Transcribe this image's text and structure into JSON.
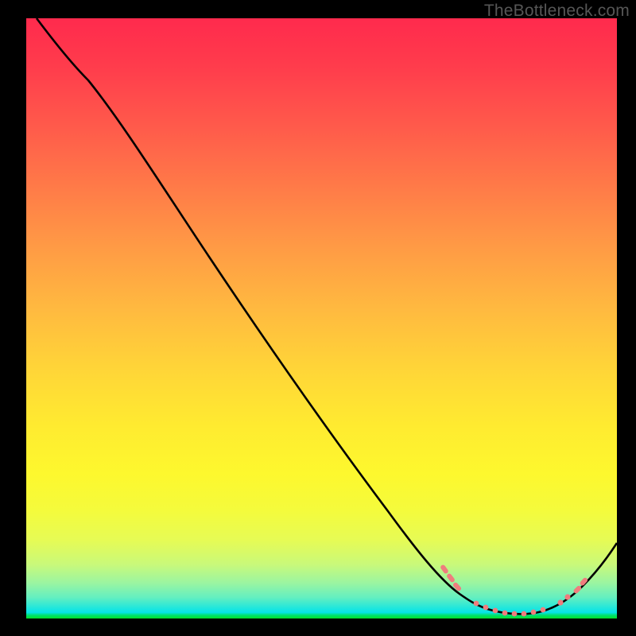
{
  "watermark": "TheBottleneck.com",
  "chart_data": {
    "type": "line",
    "title": "",
    "xlabel": "",
    "ylabel": "",
    "xlim": [
      0,
      100
    ],
    "ylim": [
      0,
      100
    ],
    "grid": false,
    "legend": false,
    "annotations": [],
    "series": [
      {
        "name": "bottleneck-curve",
        "color": "#000000",
        "x": [
          0,
          4,
          9,
          15,
          22,
          30,
          38,
          46,
          54,
          62,
          68,
          72,
          75,
          78,
          81,
          84,
          87,
          90,
          93,
          96,
          100
        ],
        "y": [
          100,
          98,
          95,
          92,
          86,
          78,
          69,
          59,
          49,
          38,
          28,
          20,
          14,
          8,
          4,
          2,
          1,
          2,
          5,
          10,
          18
        ]
      },
      {
        "name": "optimal-zone-markers",
        "color": "#f07878",
        "type": "scatter",
        "x": [
          70,
          71,
          72,
          76,
          78,
          80,
          82,
          84,
          86,
          88,
          90,
          92,
          93
        ],
        "y": [
          22,
          20,
          17,
          9,
          6,
          4,
          3,
          2,
          1,
          2,
          4,
          7,
          9
        ]
      }
    ],
    "background_gradient": {
      "orientation": "vertical",
      "stops": [
        {
          "pos": 0.0,
          "color": "#ff2a4d"
        },
        {
          "pos": 0.5,
          "color": "#ffd438"
        },
        {
          "pos": 0.9,
          "color": "#e6fb55"
        },
        {
          "pos": 1.0,
          "color": "#00df27"
        }
      ]
    }
  }
}
